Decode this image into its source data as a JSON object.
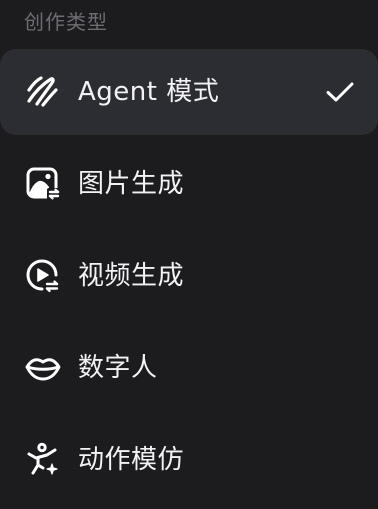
{
  "section": {
    "title": "创作类型"
  },
  "menu": {
    "items": [
      {
        "label": "Agent 模式",
        "icon": "agent-swirl-icon",
        "selected": true
      },
      {
        "label": "图片生成",
        "icon": "image-generation-icon",
        "selected": false
      },
      {
        "label": "视频生成",
        "icon": "video-generation-icon",
        "selected": false
      },
      {
        "label": "数字人",
        "icon": "lips-icon",
        "selected": false
      },
      {
        "label": "动作模仿",
        "icon": "motion-figure-icon",
        "selected": false
      }
    ]
  },
  "colors": {
    "background": "#1c1c1f",
    "selected_background": "#2c2d32",
    "section_title": "#6c6d72",
    "text": "#f2f2f4"
  }
}
